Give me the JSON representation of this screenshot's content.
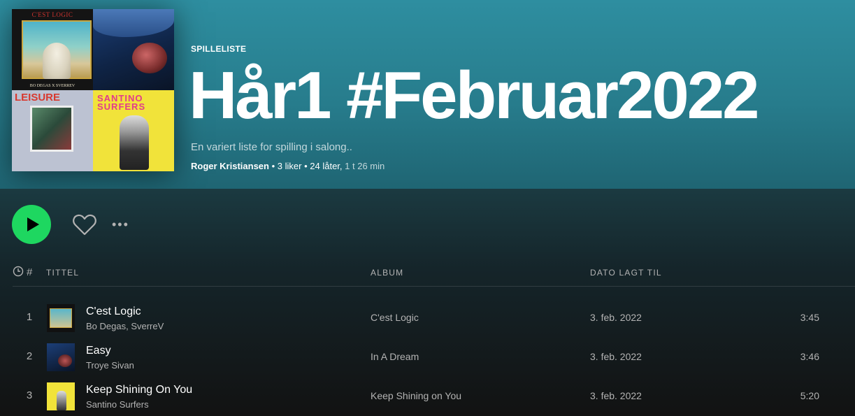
{
  "playlist": {
    "type_label": "SPILLELISTE",
    "title": "Hår1 #Februar2022",
    "description": "En variert liste for spilling i salong..",
    "owner": "Roger Kristiansen",
    "likes": "3 liker",
    "song_count": "24 låter,",
    "duration": "1 t 26 min",
    "cover": {
      "tile1_title": "C'EST LOGIC",
      "tile1_subtitle": "BO DEGAS X SVERREV",
      "tile3_side_text": "LEISURE",
      "tile4_text": "SANTINO SURFERS"
    }
  },
  "actions": {
    "more_label": "•••"
  },
  "table": {
    "headers": {
      "number": "#",
      "title": "TITTEL",
      "album": "ALBUM",
      "date": "DATO LAGT TIL"
    },
    "rows": [
      {
        "num": "1",
        "title": "C'est Logic",
        "artist": "Bo Degas, SverreV",
        "album": "C'est Logic",
        "date": "3. feb. 2022",
        "duration": "3:45"
      },
      {
        "num": "2",
        "title": "Easy",
        "artist": "Troye Sivan",
        "album": "In A Dream",
        "date": "3. feb. 2022",
        "duration": "3:46"
      },
      {
        "num": "3",
        "title": "Keep Shining On You",
        "artist": "Santino Surfers",
        "album": "Keep Shining on You",
        "date": "3. feb. 2022",
        "duration": "5:20"
      }
    ]
  },
  "colors": {
    "accent": "#1ed760",
    "header_bg": "#2e8ea0",
    "background": "#121212"
  }
}
